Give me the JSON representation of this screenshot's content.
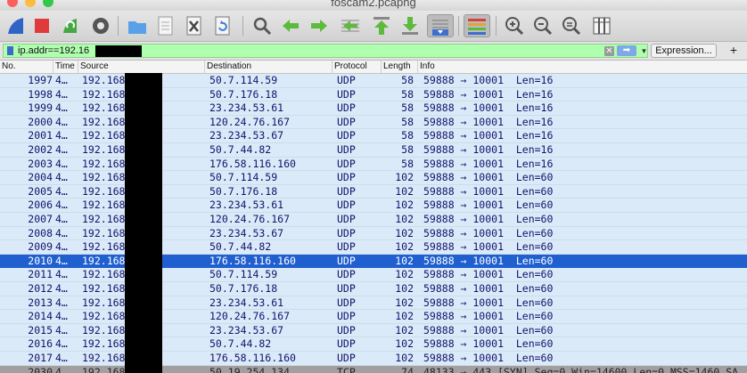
{
  "window": {
    "title": "foscam2.pcapng"
  },
  "toolbar": {
    "buttons": [
      {
        "name": "start-capture-icon",
        "color": "#2f64c6"
      },
      {
        "name": "stop-capture-icon",
        "color": "#e03b3b"
      },
      {
        "name": "restart-capture-icon",
        "color": "#45a845"
      },
      {
        "name": "capture-options-icon",
        "color": "#555555"
      },
      {
        "name": "open-file-icon",
        "color": "#5aa0e8"
      },
      {
        "name": "save-file-icon",
        "color": "#cccccc"
      },
      {
        "name": "close-file-icon",
        "color": "#666666"
      },
      {
        "name": "reload-file-icon",
        "color": "#3c7bd6"
      },
      {
        "name": "find-packet-icon",
        "color": "#555555"
      },
      {
        "name": "go-back-icon",
        "color": "#5cba3c"
      },
      {
        "name": "go-forward-icon",
        "color": "#5cba3c"
      },
      {
        "name": "go-to-packet-icon",
        "color": "#5cba3c"
      },
      {
        "name": "go-first-packet-icon",
        "color": "#5cba3c"
      },
      {
        "name": "go-last-packet-icon",
        "color": "#5cba3c"
      },
      {
        "name": "auto-scroll-icon",
        "color": "#3d6fcf"
      },
      {
        "name": "colorize-icon",
        "color": "#d94040"
      },
      {
        "name": "zoom-in-icon",
        "color": "#555555"
      },
      {
        "name": "zoom-out-icon",
        "color": "#555555"
      },
      {
        "name": "normal-size-icon",
        "color": "#555555"
      },
      {
        "name": "resize-columns-icon",
        "color": "#555555"
      }
    ]
  },
  "filter": {
    "value": "ip.addr==192.16",
    "background": "#afffaf",
    "clear_icon": "x-icon",
    "apply_icon": "arrow-right-icon",
    "dropdown_icon": "chevron-down-icon",
    "expression_label": "Expression...",
    "add_label": "+"
  },
  "columns": [
    "No.",
    "Time",
    "Source",
    "Destination",
    "Protocol",
    "Length",
    "Info"
  ],
  "packets": [
    {
      "no": "1997",
      "time": "4…",
      "src": "192.168",
      "dst": "50.7.114.59",
      "proto": "UDP",
      "len": "58",
      "info": "59888 → 10001  Len=16",
      "type": "udp"
    },
    {
      "no": "1998",
      "time": "4…",
      "src": "192.168",
      "dst": "50.7.176.18",
      "proto": "UDP",
      "len": "58",
      "info": "59888 → 10001  Len=16",
      "type": "udp"
    },
    {
      "no": "1999",
      "time": "4…",
      "src": "192.168",
      "dst": "23.234.53.61",
      "proto": "UDP",
      "len": "58",
      "info": "59888 → 10001  Len=16",
      "type": "udp"
    },
    {
      "no": "2000",
      "time": "4…",
      "src": "192.168",
      "dst": "120.24.76.167",
      "proto": "UDP",
      "len": "58",
      "info": "59888 → 10001  Len=16",
      "type": "udp"
    },
    {
      "no": "2001",
      "time": "4…",
      "src": "192.168",
      "dst": "23.234.53.67",
      "proto": "UDP",
      "len": "58",
      "info": "59888 → 10001  Len=16",
      "type": "udp"
    },
    {
      "no": "2002",
      "time": "4…",
      "src": "192.168",
      "dst": "50.7.44.82",
      "proto": "UDP",
      "len": "58",
      "info": "59888 → 10001  Len=16",
      "type": "udp"
    },
    {
      "no": "2003",
      "time": "4…",
      "src": "192.168",
      "dst": "176.58.116.160",
      "proto": "UDP",
      "len": "58",
      "info": "59888 → 10001  Len=16",
      "type": "udp"
    },
    {
      "no": "2004",
      "time": "4…",
      "src": "192.168",
      "dst": "50.7.114.59",
      "proto": "UDP",
      "len": "102",
      "info": "59888 → 10001  Len=60",
      "type": "udp"
    },
    {
      "no": "2005",
      "time": "4…",
      "src": "192.168",
      "dst": "50.7.176.18",
      "proto": "UDP",
      "len": "102",
      "info": "59888 → 10001  Len=60",
      "type": "udp"
    },
    {
      "no": "2006",
      "time": "4…",
      "src": "192.168",
      "dst": "23.234.53.61",
      "proto": "UDP",
      "len": "102",
      "info": "59888 → 10001  Len=60",
      "type": "udp"
    },
    {
      "no": "2007",
      "time": "4…",
      "src": "192.168",
      "dst": "120.24.76.167",
      "proto": "UDP",
      "len": "102",
      "info": "59888 → 10001  Len=60",
      "type": "udp"
    },
    {
      "no": "2008",
      "time": "4…",
      "src": "192.168",
      "dst": "23.234.53.67",
      "proto": "UDP",
      "len": "102",
      "info": "59888 → 10001  Len=60",
      "type": "udp"
    },
    {
      "no": "2009",
      "time": "4…",
      "src": "192.168",
      "dst": "50.7.44.82",
      "proto": "UDP",
      "len": "102",
      "info": "59888 → 10001  Len=60",
      "type": "udp"
    },
    {
      "no": "2010",
      "time": "4…",
      "src": "192.168",
      "dst": "176.58.116.160",
      "proto": "UDP",
      "len": "102",
      "info": "59888 → 10001  Len=60",
      "type": "selected"
    },
    {
      "no": "2011",
      "time": "4…",
      "src": "192.168",
      "dst": "50.7.114.59",
      "proto": "UDP",
      "len": "102",
      "info": "59888 → 10001  Len=60",
      "type": "udp"
    },
    {
      "no": "2012",
      "time": "4…",
      "src": "192.168",
      "dst": "50.7.176.18",
      "proto": "UDP",
      "len": "102",
      "info": "59888 → 10001  Len=60",
      "type": "udp"
    },
    {
      "no": "2013",
      "time": "4…",
      "src": "192.168",
      "dst": "23.234.53.61",
      "proto": "UDP",
      "len": "102",
      "info": "59888 → 10001  Len=60",
      "type": "udp"
    },
    {
      "no": "2014",
      "time": "4…",
      "src": "192.168",
      "dst": "120.24.76.167",
      "proto": "UDP",
      "len": "102",
      "info": "59888 → 10001  Len=60",
      "type": "udp"
    },
    {
      "no": "2015",
      "time": "4…",
      "src": "192.168",
      "dst": "23.234.53.67",
      "proto": "UDP",
      "len": "102",
      "info": "59888 → 10001  Len=60",
      "type": "udp"
    },
    {
      "no": "2016",
      "time": "4…",
      "src": "192.168",
      "dst": "50.7.44.82",
      "proto": "UDP",
      "len": "102",
      "info": "59888 → 10001  Len=60",
      "type": "udp"
    },
    {
      "no": "2017",
      "time": "4…",
      "src": "192.168",
      "dst": "176.58.116.160",
      "proto": "UDP",
      "len": "102",
      "info": "59888 → 10001  Len=60",
      "type": "udp"
    },
    {
      "no": "2030",
      "time": "4…",
      "src": "192.168",
      "dst": "50.19.254.134",
      "proto": "TCP",
      "len": "74",
      "info": "48133 → 443 [SYN] Seq=0 Win=14600 Len=0 MSS=1460 SA",
      "type": "tcp"
    }
  ]
}
